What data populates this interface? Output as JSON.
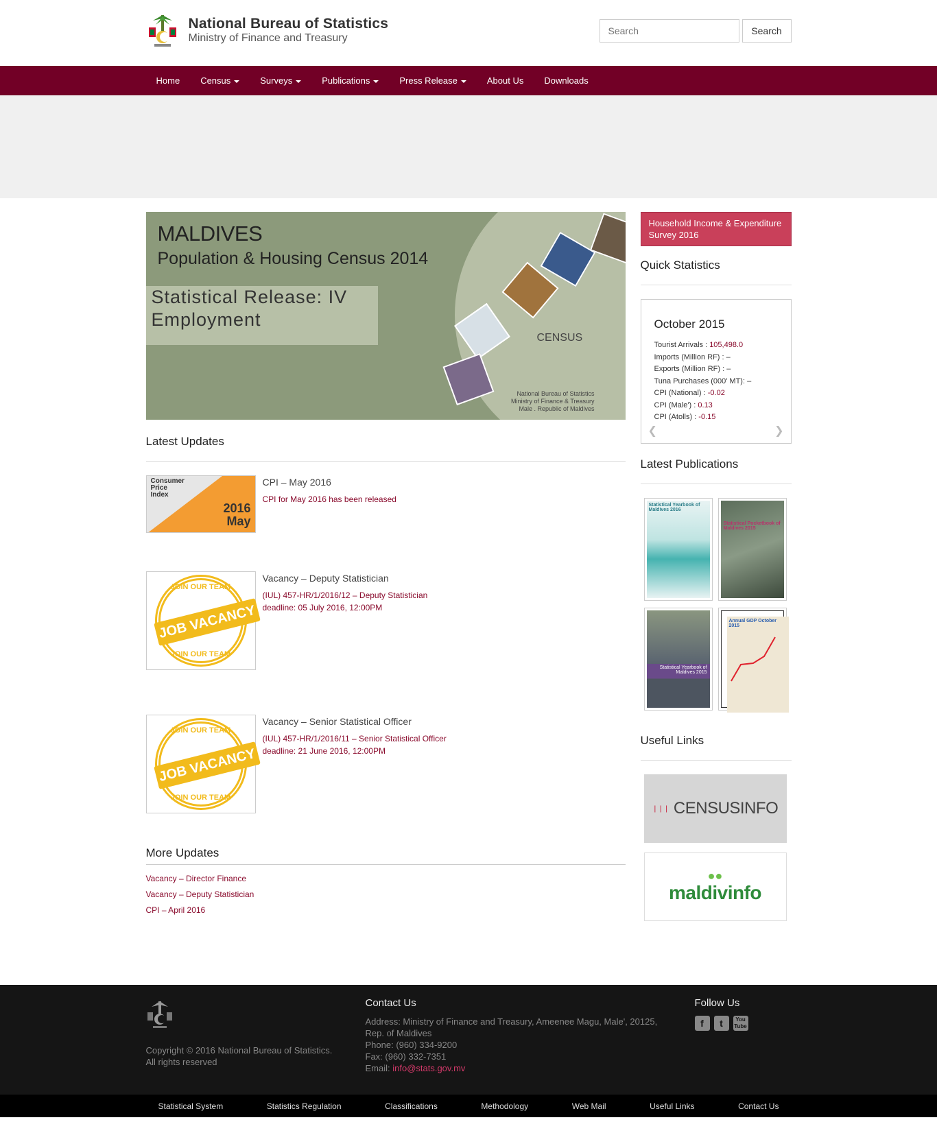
{
  "header": {
    "org_title": "National Bureau of Statistics",
    "org_subtitle": "Ministry of Finance and Treasury",
    "search_placeholder": "Search",
    "search_button": "Search"
  },
  "nav": {
    "items": [
      {
        "label": "Home",
        "dropdown": false
      },
      {
        "label": "Census",
        "dropdown": true
      },
      {
        "label": "Surveys",
        "dropdown": true
      },
      {
        "label": "Publications",
        "dropdown": true
      },
      {
        "label": "Press Release",
        "dropdown": true
      },
      {
        "label": "About Us",
        "dropdown": false
      },
      {
        "label": "Downloads",
        "dropdown": false
      }
    ],
    "color": "#720026"
  },
  "banner": {
    "line1": "MALDIVES",
    "line2": "Population & Housing Census 2014",
    "release_line1": "Statistical Release: IV",
    "release_line2": "Employment",
    "census_logo": "CENSUS",
    "credit_line1": "National Bureau of Statistics",
    "credit_line2": "Ministry of Finance & Treasury",
    "credit_line3": "Male . Republic of Maldives"
  },
  "latest_updates": {
    "heading": "Latest Updates",
    "items": [
      {
        "title": "CPI – May 2016",
        "desc1": "CPI for May 2016 has been released",
        "desc2": "",
        "thumb": "cpi",
        "thumb_label1": "Consumer",
        "thumb_label2": "Price",
        "thumb_label3": "Index",
        "thumb_year": "2016",
        "thumb_month": "May"
      },
      {
        "title": "Vacancy – Deputy Statistician",
        "desc1": "(IUL) 457-HR/1/2016/12 – Deputy Statistician",
        "desc2": "deadline: 05 July 2016, 12:00PM",
        "thumb": "stamp"
      },
      {
        "title": "Vacancy – Senior Statistical Officer",
        "desc1": "(IUL) 457-HR/1/2016/11 – Senior Statistical Officer",
        "desc2": "deadline: 21 June 2016, 12:00PM",
        "thumb": "stamp"
      }
    ],
    "stamp_top": "JOIN OUR TEAM",
    "stamp_band": "JOB VACANCY",
    "stamp_bottom": "JOIN OUR TEAM"
  },
  "more_updates": {
    "heading": "More Updates",
    "links": [
      "Vacancy – Director Finance",
      "Vacancy – Deputy Statistician",
      "CPI – April 2016"
    ]
  },
  "sidebar": {
    "hies_button": "Household Income & Expenditure Survey 2016",
    "quick_stats_heading": "Quick Statistics",
    "quick_stats": {
      "month": "October 2015",
      "rows": [
        {
          "label": "Tourist Arrivals : ",
          "value": "105,498.0"
        },
        {
          "label": "Imports (Million RF) : ",
          "value": "–"
        },
        {
          "label": "Exports (Million RF) : ",
          "value": "–"
        },
        {
          "label": "Tuna Purchases (000' MT): ",
          "value": "–"
        },
        {
          "label": "CPI (National) : ",
          "value": "-0.02"
        },
        {
          "label": "CPI (Male') : ",
          "value": "0.13"
        },
        {
          "label": "CPI (Atolls) : ",
          "value": "-0.15"
        }
      ]
    },
    "latest_pubs_heading": "Latest Publications",
    "pub_titles": [
      "Statistical Yearbook of Maldives 2016",
      "Statistical Pocketbook of Maldives 2015",
      "Statistical Yearbook of Maldives 2015",
      "Annual GDP October 2015"
    ],
    "useful_links_heading": "Useful Links",
    "useful_link1": "CENSUSINFO",
    "useful_link2": "maldivinfo"
  },
  "footer": {
    "copyright1": "Copyright © 2016 National Bureau of Statistics.",
    "copyright2": "All rights reserved",
    "contact_heading": "Contact Us",
    "address1": "Address: Ministry of Finance and Treasury, Ameenee Magu, Male', 20125,",
    "address2": "Rep. of Maldives",
    "phone": "Phone: (960) 334-9200",
    "fax": "Fax: (960) 332-7351",
    "email_label": "Email: ",
    "email": "info@stats.gov.mv",
    "follow_heading": "Follow Us",
    "social": [
      "facebook-icon",
      "twitter-icon",
      "youtube-icon"
    ],
    "bottom_links": [
      "Statistical System",
      "Statistics Regulation",
      "Classifications",
      "Methodology",
      "Web Mail",
      "Useful Links",
      "Contact Us"
    ]
  }
}
